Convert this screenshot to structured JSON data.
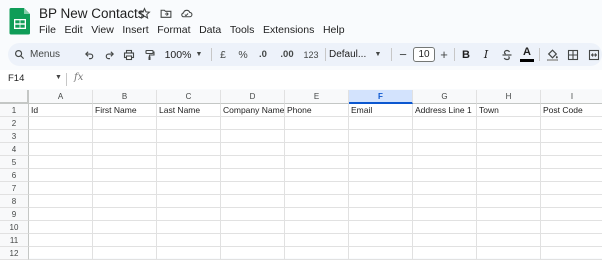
{
  "app": {
    "doc_title": "BP New Contacts",
    "menu": [
      "File",
      "Edit",
      "View",
      "Insert",
      "Format",
      "Data",
      "Tools",
      "Extensions",
      "Help"
    ]
  },
  "toolbar": {
    "search_label": "Menus",
    "zoom": "100%",
    "currency": "£",
    "percent": "%",
    "dec_decrease": ".0",
    "dec_increase": ".00",
    "number_format": "123",
    "font": "Defaul...",
    "font_size": "10",
    "minus": "−",
    "plus": "+",
    "bold": "B",
    "italic": "I",
    "text_color": "A"
  },
  "formula_bar": {
    "name_box": "F14",
    "fx": "fx",
    "value": ""
  },
  "grid": {
    "selected_column": "F",
    "columns": [
      "A",
      "B",
      "C",
      "D",
      "E",
      "F",
      "G",
      "H",
      "I"
    ],
    "rows": [
      "1",
      "2",
      "3",
      "4",
      "5",
      "6",
      "7",
      "8",
      "9",
      "10",
      "11",
      "12"
    ],
    "header_row": [
      "Id",
      "First Name",
      "Last Name",
      "Company Name",
      "Phone",
      "Email",
      "Address Line 1",
      "Town",
      "Post Code"
    ]
  },
  "colors": {
    "sheets_green": "#0f9d58",
    "selection_blue": "#0b57d0",
    "toolbar_bg": "#edf2fa"
  }
}
